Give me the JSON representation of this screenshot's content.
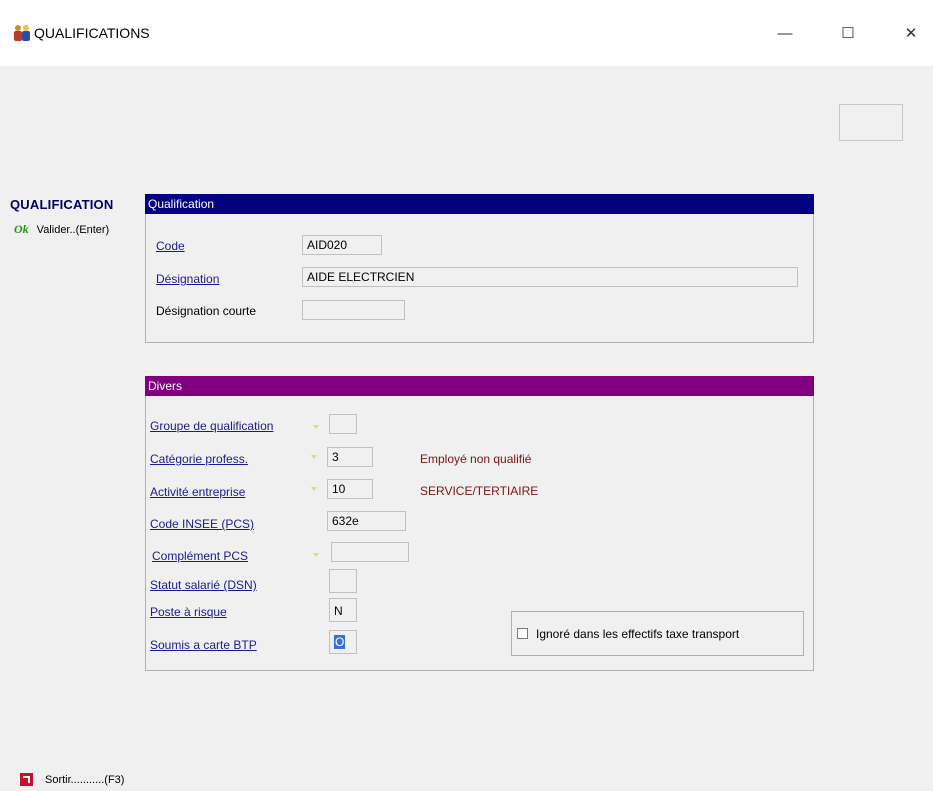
{
  "window": {
    "title": "QUALIFICATIONS",
    "minimize": "—",
    "maximize": "☐",
    "close": "✕"
  },
  "sidebar": {
    "title": "QUALIFICATION",
    "ok_icon": "Ok",
    "validate_label": "Valider..(Enter)",
    "exit_label": "Sortir...........(F3)"
  },
  "qualification": {
    "header": "Qualification",
    "code_label": "Code",
    "code_value": "AID020",
    "designation_label": "Désignation",
    "designation_value": "AIDE ELECTRCIEN",
    "short_label": "Désignation courte",
    "short_value": ""
  },
  "divers": {
    "header": "Divers",
    "groupe_label": "Groupe de qualification",
    "groupe_value": "",
    "categorie_label": "Catégorie profess.",
    "categorie_value": "3",
    "categorie_desc": "Employé non qualifié",
    "activite_label": "Activité entreprise",
    "activite_value": "10",
    "activite_desc": "SERVICE/TERTIAIRE",
    "insee_label": "Code INSEE (PCS)",
    "insee_value": "632e",
    "complement_label": "Complément PCS",
    "complement_value": "",
    "statut_label": "Statut salarié (DSN)",
    "statut_value": "",
    "poste_label": "Poste à risque",
    "poste_value": "N",
    "btp_label": "Soumis a carte BTP",
    "btp_value": "O",
    "ignore_label": "Ignoré dans les effectifs taxe transport"
  },
  "colors": {
    "qualification_header": "#000080",
    "divers_header": "#800080",
    "label_link": "#1a1a8c",
    "description": "#7a1414"
  }
}
